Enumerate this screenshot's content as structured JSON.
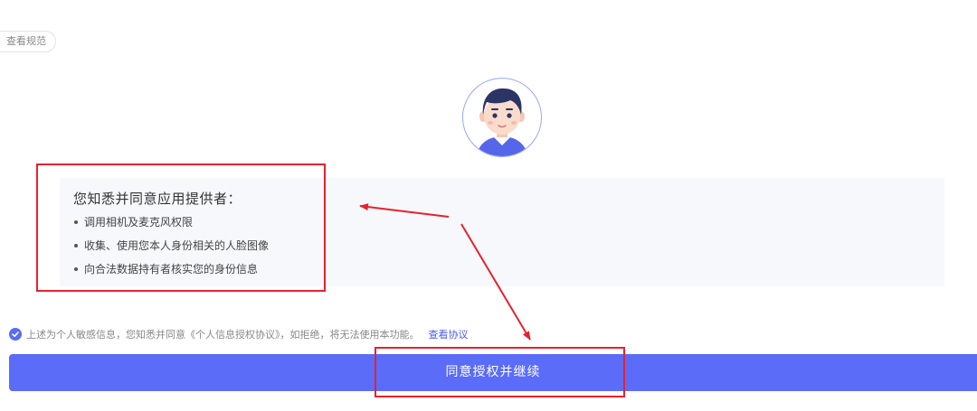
{
  "header": {
    "spec_link_label": "查看规范"
  },
  "avatar": {
    "icon": "person-avatar-icon"
  },
  "info": {
    "title": "您知悉并同意应用提供者：",
    "items": [
      "调用相机及麦克风权限",
      "收集、使用您本人身份相关的人脸图像",
      "向合法数据持有者核实您的身份信息"
    ]
  },
  "consent": {
    "checked": true,
    "text": "上述为个人敏感信息，您知悉并同意《个人信息授权协议》，如拒绝，将无法使用本功能。",
    "link_label": "查看协议"
  },
  "actions": {
    "agree_button_label": "同意授权并继续"
  },
  "annotations": {
    "color": "#e8212d"
  },
  "colors": {
    "accent": "#5a6cf8",
    "panel_bg": "#f7f8fc",
    "link": "#4a5cf0"
  }
}
